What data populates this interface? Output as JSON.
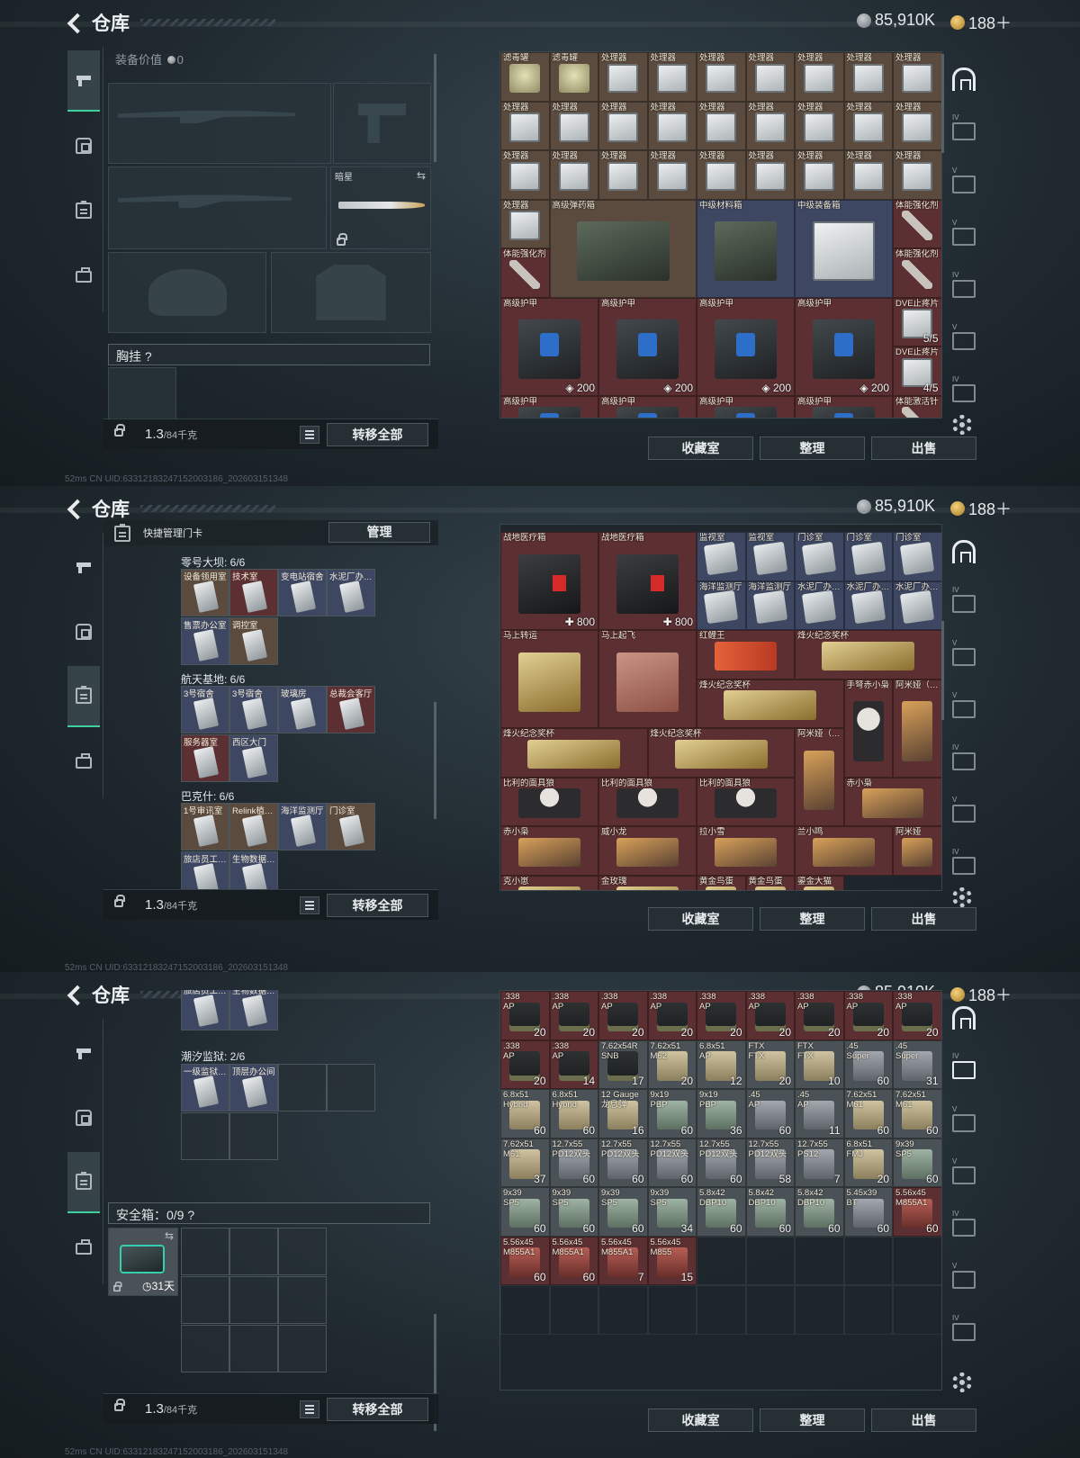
{
  "header": {
    "title": "仓库",
    "silver": "85,910K",
    "gold": "188＋",
    "status": "52ms     CN UID:63312183247152003186_202603151348"
  },
  "left": {
    "equip_label": "装备价值",
    "equip_value": "0",
    "dark_star": "暗星",
    "chest_label": "胸挂",
    "chest_q": "?",
    "weight": "1.3",
    "weight_unit": "/84千克",
    "transfer_all": "转移全部",
    "keycard_title": "快捷管理门卡",
    "manage": "管理",
    "safe_label": "安全箱：0/9",
    "safe_q": "?",
    "safe_days": "31天"
  },
  "actions": {
    "collection": "收藏室",
    "sort": "整理",
    "sell": "出售"
  },
  "icons": {
    "back": "chevron-left-icon",
    "silver": "silver-coin-icon",
    "gold": "gold-coin-icon",
    "settings": "gear-icon"
  },
  "keycards": {
    "g1": {
      "title": "零号大坝: 6/6",
      "items": [
        "设备领用室",
        "技术室",
        "变电站宿舍",
        "水泥厂办…",
        "售票办公室",
        "调控室"
      ]
    },
    "g2": {
      "title": "航天基地: 6/6",
      "items": [
        "3号宿舍",
        "3号宿舍",
        "玻璃房",
        "总裁会客厅",
        "服务器室",
        "西区大门"
      ]
    },
    "g3": {
      "title": "巴克什: 6/6",
      "items": [
        "1号审讯室",
        "Relink植…",
        "海洋监测厅",
        "门诊室",
        "旅店员工…",
        "生物数据…"
      ]
    },
    "g4": {
      "title": "潮汐监狱: 2/6",
      "items": [
        "旅店员工…",
        "生物数据…",
        "一级监狱…",
        "顶层办公间"
      ]
    }
  },
  "grid1": [
    {
      "n": "滤毒罐",
      "c": "",
      "col": "c-brown",
      "a": "a-can"
    },
    {
      "n": "滤毒罐",
      "c": "",
      "col": "c-brown",
      "a": "a-can"
    },
    {
      "n": "处理器",
      "c": "",
      "col": "c-brown",
      "a": "a-white"
    },
    {
      "n": "处理器",
      "c": "",
      "col": "c-brown",
      "a": "a-white"
    },
    {
      "n": "处理器",
      "c": "",
      "col": "c-brown",
      "a": "a-white"
    },
    {
      "n": "处理器",
      "c": "",
      "col": "c-brown",
      "a": "a-white"
    },
    {
      "n": "处理器",
      "c": "",
      "col": "c-brown",
      "a": "a-white"
    },
    {
      "n": "处理器",
      "c": "",
      "col": "c-brown",
      "a": "a-white"
    },
    {
      "n": "处理器",
      "c": "",
      "col": "c-brown",
      "a": "a-white"
    }
  ],
  "grid1b": {
    "armor": "高级护甲",
    "armor_val": "200",
    "ammo_box": "高级弹药箱",
    "mat_box": "中级材料箱",
    "equip_box": "中级装备箱",
    "stim": "体能强化剂",
    "dve1": "DVE止疼片",
    "dve1c": "5/5",
    "dve2": "DVE止疼片",
    "dve2c": "4/5",
    "proc": "处理器",
    "next": "高级护甲",
    "stim2": "体能激活针"
  },
  "grid2": {
    "medkit": "战地医疗箱",
    "medkit_val": "800",
    "row1": [
      "监视室",
      "监视室",
      "门诊室",
      "门诊室",
      "门诊室"
    ],
    "row2": [
      "海洋监测厅",
      "海洋监测厅",
      "水泥厂办…",
      "水泥厂办…",
      "水泥厂办…"
    ],
    "wheel": "马上转运",
    "horse": "马上起飞",
    "fish": "红鲤王",
    "trophy": "烽火纪念奖杯",
    "doll1": "手弩赤小枭",
    "doll2": "阿米娅（…",
    "doll3": "阿米娅（…",
    "jig": "比利的面具狼",
    "chi": "赤小枭",
    "wei": "威小龙",
    "la": "拉小雪",
    "lan": "兰小鸣",
    "ami": "阿米娅",
    "bottom": [
      "克小崽",
      "金玫瑰",
      "黄金鸟蛋",
      "黄金鸟蛋",
      "鎏金大猫"
    ]
  },
  "grid3": [
    [
      ".338\nAP",
      "20"
    ],
    [
      ".338\nAP",
      "20"
    ],
    [
      ".338\nAP",
      "20"
    ],
    [
      ".338\nAP",
      "20"
    ],
    [
      ".338\nAP",
      "20"
    ],
    [
      ".338\nAP",
      "20"
    ],
    [
      ".338\nAP",
      "20"
    ],
    [
      ".338\nAP",
      "20"
    ],
    [
      ".338\nAP",
      "20"
    ],
    [
      ".338\nAP",
      "20"
    ],
    [
      ".338\nAP",
      "14"
    ],
    [
      "7.62x54R\nSNB",
      "17"
    ],
    [
      "7.62x51\nM62",
      "20"
    ],
    [
      "6.8x51\nAP",
      "12"
    ],
    [
      "FTX\nFTX",
      "20"
    ],
    [
      "FTX\nFTX",
      "10"
    ],
    [
      ".45\nSuper",
      "60"
    ],
    [
      ".45\nSuper",
      "31"
    ],
    [
      "6.8x51\nHybrid",
      "60"
    ],
    [
      "6.8x51\nHybrid",
      "60"
    ],
    [
      "12 Gauge\n龙息弹",
      "16"
    ],
    [
      "9x19\nPBP",
      "60"
    ],
    [
      "9x19\nPBP",
      "36"
    ],
    [
      ".45\nAP",
      "60"
    ],
    [
      ".45\nAP",
      "11"
    ],
    [
      "7.62x51\nM61",
      "60"
    ],
    [
      "7.62x51\nM61",
      "60"
    ],
    [
      "7.62x51\nM61",
      "37"
    ],
    [
      "12.7x55\nPD12双头",
      "60"
    ],
    [
      "12.7x55\nPD12双头",
      "60"
    ],
    [
      "12.7x55\nPD12双头",
      "60"
    ],
    [
      "12.7x55\nPD12双头",
      "60"
    ],
    [
      "12.7x55\nPD12双头",
      "58"
    ],
    [
      "12.7x55\nPS12",
      "7"
    ],
    [
      "6.8x51\nFMJ",
      "20"
    ],
    [
      "9x39\nSP5",
      "60"
    ],
    [
      "9x39\nSP5",
      "60"
    ],
    [
      "9x39\nSP5",
      "60"
    ],
    [
      "9x39\nSP5",
      "60"
    ],
    [
      "9x39\nSP5",
      "34"
    ],
    [
      "5.8x42\nDBP10",
      "60"
    ],
    [
      "5.8x42\nDBP10",
      "60"
    ],
    [
      "5.8x42\nDBP10",
      "60"
    ],
    [
      "5.45x39\nBT",
      "60"
    ],
    [
      "5.56x45\nM855A1",
      "60"
    ],
    [
      "5.56x45\nM855A1",
      "60"
    ],
    [
      "5.56x45\nM855A1",
      "60"
    ],
    [
      "5.56x45\nM855A1",
      "7"
    ],
    [
      "5.56x45\nM855",
      "15"
    ]
  ]
}
